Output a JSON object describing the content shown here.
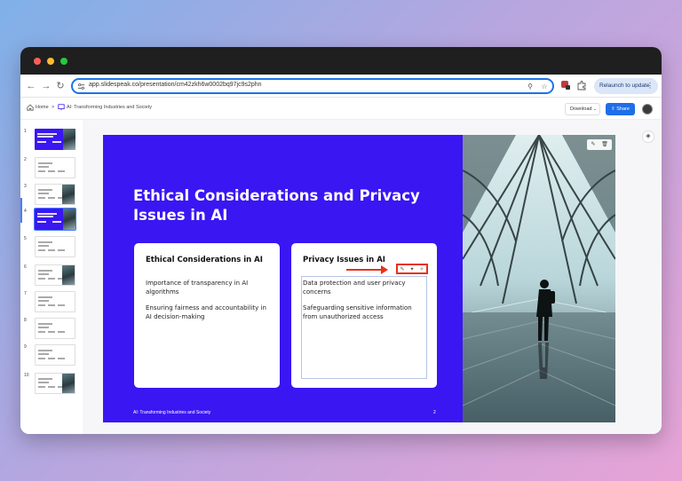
{
  "browser": {
    "url": "app.slidespeak.co/presentation/cm42zkh6w0002bq97jc9s2phn",
    "relaunch_label": "Relaunch to update"
  },
  "app": {
    "breadcrumb_home": "Home",
    "breadcrumb_separator": ">",
    "presentation_title": "AI: Transforming Industries and Society",
    "download_label": "Download",
    "share_label": "Share"
  },
  "thumbnails": [
    {
      "number": "1",
      "style": "blue"
    },
    {
      "number": "2",
      "style": "white"
    },
    {
      "number": "3",
      "style": "white"
    },
    {
      "number": "4",
      "style": "blue",
      "selected": true
    },
    {
      "number": "5",
      "style": "white"
    },
    {
      "number": "6",
      "style": "white"
    },
    {
      "number": "7",
      "style": "white"
    },
    {
      "number": "8",
      "style": "white"
    },
    {
      "number": "9",
      "style": "white"
    },
    {
      "number": "10",
      "style": "white"
    }
  ],
  "slide": {
    "title": "Ethical Considerations and Privacy Issues in AI",
    "left_card": {
      "title": "Ethical Considerations in AI",
      "items": [
        "Importance of transparency in AI algorithms",
        "Ensuring fairness and accountability in AI decision-making"
      ]
    },
    "right_card": {
      "title": "Privacy Issues in AI",
      "items": [
        "Data protection and user privacy concerns",
        "Safeguarding sensitive information from unauthorized access"
      ]
    },
    "footer_left": "AI: Transforming Industries and Society",
    "page_number": "2"
  },
  "colors": {
    "slide_background": "#3a16f2",
    "accent": "#1e6ee8",
    "highlight": "#e8311a"
  }
}
